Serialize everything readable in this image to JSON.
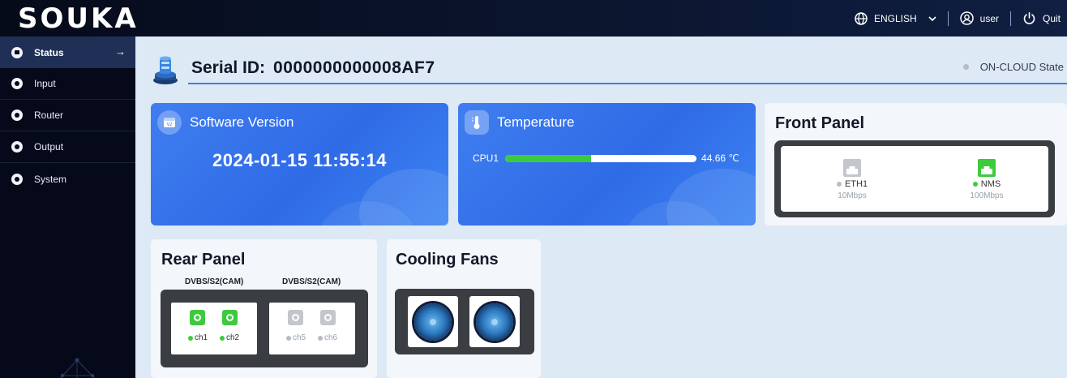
{
  "app": {
    "logo": "SOUKA",
    "language_label": "ENGLISH",
    "user_label": "user",
    "quit_label": "Quit"
  },
  "sidebar": {
    "items": [
      {
        "label": "Status",
        "active": true
      },
      {
        "label": "Input"
      },
      {
        "label": "Router"
      },
      {
        "label": "Output"
      },
      {
        "label": "System"
      }
    ]
  },
  "header": {
    "serial_label": "Serial ID:",
    "serial_value": "0000000000008AF7",
    "cloud_state": "ON-CLOUD State"
  },
  "software": {
    "title": "Software Version",
    "date": "2024-01-15 11:55:14"
  },
  "temperature": {
    "title": "Temperature",
    "sensor": "CPU1",
    "value": "44.66 ℃",
    "level_fraction": 0.45
  },
  "front_panel": {
    "title": "Front Panel",
    "ports": [
      {
        "name": "ETH1",
        "speed": "10Mbps",
        "status": "inactive"
      },
      {
        "name": "NMS",
        "speed": "100Mbps",
        "status": "active"
      }
    ]
  },
  "rear_panel": {
    "title": "Rear Panel",
    "modules": [
      {
        "label": "DVBS/S2(CAM)",
        "channels": [
          {
            "name": "ch1",
            "active": true
          },
          {
            "name": "ch2",
            "active": true
          }
        ]
      },
      {
        "label": "DVBS/S2(CAM)",
        "channels": [
          {
            "name": "ch5",
            "active": false
          },
          {
            "name": "ch6",
            "active": false
          }
        ]
      }
    ]
  },
  "cooling_fans": {
    "title": "Cooling Fans",
    "fan_count": 2
  },
  "colors": {
    "accent_blue": "#2f6be6",
    "active_green": "#3ccb3c",
    "inactive_gray": "#b5bcc8",
    "sidebar_bg": "#05091a"
  }
}
